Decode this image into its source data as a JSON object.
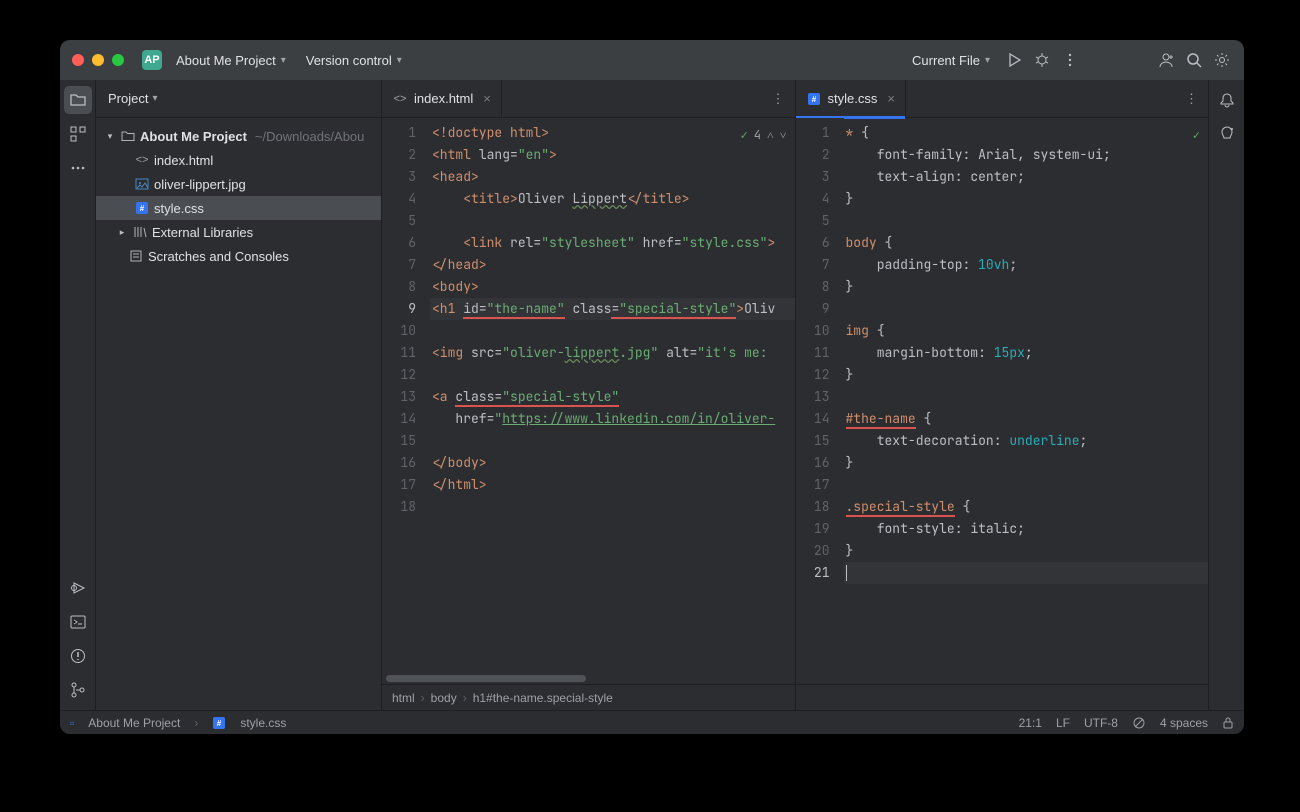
{
  "titlebar": {
    "badge": "AP",
    "project": "About Me Project",
    "vcs": "Version control",
    "runconfig": "Current File"
  },
  "sidebar": {
    "title": "Project",
    "root": {
      "name": "About Me Project",
      "path": "~/Downloads/Abou"
    },
    "files": [
      {
        "name": "index.html",
        "kind": "html"
      },
      {
        "name": "oliver-lippert.jpg",
        "kind": "img"
      },
      {
        "name": "style.css",
        "kind": "css",
        "selected": true
      }
    ],
    "extlib": "External Libraries",
    "scratches": "Scratches and Consoles"
  },
  "editor_left": {
    "tab": "index.html",
    "inspection_count": "4",
    "breadcrumb": [
      "html",
      "body",
      "h1#the-name.special-style"
    ],
    "current_line": 9,
    "lines": [
      {
        "n": 1,
        "tokens": [
          [
            "<!doctype ",
            "tag"
          ],
          [
            "html",
            "tag"
          ],
          [
            ">",
            "tag"
          ]
        ]
      },
      {
        "n": 2,
        "tokens": [
          [
            "<html ",
            "tag"
          ],
          [
            "lang",
            "attr"
          ],
          [
            "=",
            "punc"
          ],
          [
            "\"en\"",
            "str"
          ],
          [
            ">",
            "tag"
          ]
        ]
      },
      {
        "n": 3,
        "tokens": [
          [
            "<head>",
            "tag"
          ]
        ]
      },
      {
        "n": 4,
        "tokens": [
          [
            "    ",
            ""
          ],
          [
            "<title>",
            "tag"
          ],
          [
            "Oliver ",
            ""
          ],
          [
            "Lippert",
            "",
            "wavy"
          ],
          [
            "</title>",
            "tag"
          ]
        ]
      },
      {
        "n": 5,
        "tokens": []
      },
      {
        "n": 6,
        "tokens": [
          [
            "    ",
            ""
          ],
          [
            "<link ",
            "tag"
          ],
          [
            "rel",
            "attr"
          ],
          [
            "=",
            "punc"
          ],
          [
            "\"stylesheet\"",
            "str"
          ],
          [
            " ",
            ""
          ],
          [
            "href",
            "attr"
          ],
          [
            "=",
            "punc"
          ],
          [
            "\"style.css\"",
            "str"
          ],
          [
            ">",
            "tag"
          ]
        ]
      },
      {
        "n": 7,
        "tokens": [
          [
            "</head>",
            "tag"
          ]
        ]
      },
      {
        "n": 8,
        "tokens": [
          [
            "<body>",
            "tag"
          ]
        ]
      },
      {
        "n": 9,
        "tokens": [
          [
            "<h1 ",
            "tag"
          ],
          [
            "id",
            "attr",
            "red"
          ],
          [
            "=",
            "punc",
            "red"
          ],
          [
            "\"the-name\"",
            "str",
            "red"
          ],
          [
            " ",
            ""
          ],
          [
            "class",
            "attr"
          ],
          [
            "=",
            "punc",
            "red"
          ],
          [
            "\"special-style\"",
            "str",
            "red"
          ],
          [
            ">",
            "tag"
          ],
          [
            "Oliv",
            ""
          ]
        ]
      },
      {
        "n": 10,
        "tokens": []
      },
      {
        "n": 11,
        "tokens": [
          [
            "<img ",
            "tag"
          ],
          [
            "src",
            "attr"
          ],
          [
            "=",
            "punc"
          ],
          [
            "\"oliver-",
            "str"
          ],
          [
            "lippert",
            "str",
            "wavy"
          ],
          [
            ".jpg\"",
            "str"
          ],
          [
            " ",
            ""
          ],
          [
            "alt",
            "attr"
          ],
          [
            "=",
            "punc"
          ],
          [
            "\"it's me:",
            "str"
          ]
        ]
      },
      {
        "n": 12,
        "tokens": []
      },
      {
        "n": 13,
        "tokens": [
          [
            "<a ",
            "tag"
          ],
          [
            "class",
            "attr",
            "red"
          ],
          [
            "=",
            "punc",
            "red"
          ],
          [
            "\"special-style\"",
            "str",
            "red"
          ]
        ]
      },
      {
        "n": 14,
        "tokens": [
          [
            "   ",
            ""
          ],
          [
            "href",
            "attr"
          ],
          [
            "=",
            "punc"
          ],
          [
            "\"",
            "str"
          ],
          [
            "https://www.linkedin.com/in/oliver-",
            "str",
            "link"
          ]
        ]
      },
      {
        "n": 15,
        "tokens": []
      },
      {
        "n": 16,
        "tokens": [
          [
            "</body>",
            "tag"
          ]
        ]
      },
      {
        "n": 17,
        "tokens": [
          [
            "</html>",
            "tag"
          ]
        ]
      },
      {
        "n": 18,
        "tokens": []
      }
    ]
  },
  "editor_right": {
    "tab": "style.css",
    "current_line": 21,
    "lines": [
      {
        "n": 1,
        "tokens": [
          [
            "* ",
            "sel"
          ],
          [
            "{",
            "punc"
          ]
        ]
      },
      {
        "n": 2,
        "tokens": [
          [
            "    font-family",
            "prop"
          ],
          [
            ": ",
            "punc"
          ],
          [
            "Arial",
            ""
          ],
          [
            ", ",
            "punc"
          ],
          [
            "system-ui",
            ""
          ],
          [
            ";",
            "punc"
          ]
        ]
      },
      {
        "n": 3,
        "tokens": [
          [
            "    text-align",
            "prop"
          ],
          [
            ": ",
            "punc"
          ],
          [
            "center",
            ""
          ],
          [
            ";",
            "punc"
          ]
        ]
      },
      {
        "n": 4,
        "tokens": [
          [
            "}",
            "punc"
          ]
        ]
      },
      {
        "n": 5,
        "tokens": []
      },
      {
        "n": 6,
        "tokens": [
          [
            "body ",
            "sel"
          ],
          [
            "{",
            "punc"
          ]
        ]
      },
      {
        "n": 7,
        "tokens": [
          [
            "    padding-top",
            "prop"
          ],
          [
            ": ",
            "punc"
          ],
          [
            "10vh",
            "num"
          ],
          [
            ";",
            "punc"
          ]
        ]
      },
      {
        "n": 8,
        "tokens": [
          [
            "}",
            "punc"
          ]
        ]
      },
      {
        "n": 9,
        "tokens": []
      },
      {
        "n": 10,
        "tokens": [
          [
            "img ",
            "sel"
          ],
          [
            "{",
            "punc"
          ]
        ]
      },
      {
        "n": 11,
        "tokens": [
          [
            "    margin-bottom",
            "prop"
          ],
          [
            ": ",
            "punc"
          ],
          [
            "15px",
            "num"
          ],
          [
            ";",
            "punc"
          ]
        ]
      },
      {
        "n": 12,
        "tokens": [
          [
            "}",
            "punc"
          ]
        ]
      },
      {
        "n": 13,
        "tokens": []
      },
      {
        "n": 14,
        "tokens": [
          [
            "#the-name",
            "id",
            "red"
          ],
          [
            " {",
            "punc"
          ]
        ]
      },
      {
        "n": 15,
        "tokens": [
          [
            "    text-decoration",
            "prop"
          ],
          [
            ": ",
            "punc"
          ],
          [
            "underline",
            "num"
          ],
          [
            ";",
            "punc"
          ]
        ]
      },
      {
        "n": 16,
        "tokens": [
          [
            "}",
            "punc"
          ]
        ]
      },
      {
        "n": 17,
        "tokens": []
      },
      {
        "n": 18,
        "tokens": [
          [
            ".special-style",
            "id",
            "red"
          ],
          [
            " {",
            "punc"
          ]
        ]
      },
      {
        "n": 19,
        "tokens": [
          [
            "    font-style",
            "prop"
          ],
          [
            ": ",
            "punc"
          ],
          [
            "italic",
            ""
          ],
          [
            ";",
            "punc"
          ]
        ]
      },
      {
        "n": 20,
        "tokens": [
          [
            "}",
            "punc"
          ]
        ]
      },
      {
        "n": 21,
        "tokens": [],
        "caret": true
      }
    ]
  },
  "status": {
    "crumb1": "About Me Project",
    "crumb2": "style.css",
    "pos": "21:1",
    "sep": "LF",
    "enc": "UTF-8",
    "indent": "4 spaces"
  }
}
